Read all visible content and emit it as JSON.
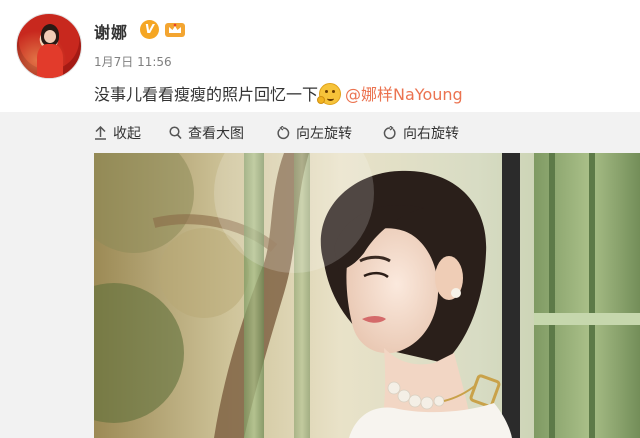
{
  "post": {
    "username": "谢娜",
    "verified_badge": "V",
    "timestamp": "1月7日 11:56",
    "text": "没事儿看看瘦瘦的照片回忆一下",
    "mention": "@娜样NaYoung"
  },
  "toolbar": {
    "collapse_label": "收起",
    "view_large_label": "查看大图",
    "rotate_left_label": "向左旋转",
    "rotate_right_label": "向右旋转"
  },
  "icons": {
    "avatar": "avatar-image",
    "verified": "verified-v-icon",
    "member": "crown-icon",
    "emoji": "thinking-emoji-icon",
    "collapse": "collapse-arrow-icon",
    "zoom": "magnifier-icon",
    "rotate_left": "rotate-left-icon",
    "rotate_right": "rotate-right-icon"
  },
  "colors": {
    "text": "#333333",
    "muted": "#808080",
    "mention": "#eb7350",
    "badge": "#f5a623",
    "panel": "#f2f2f2"
  }
}
